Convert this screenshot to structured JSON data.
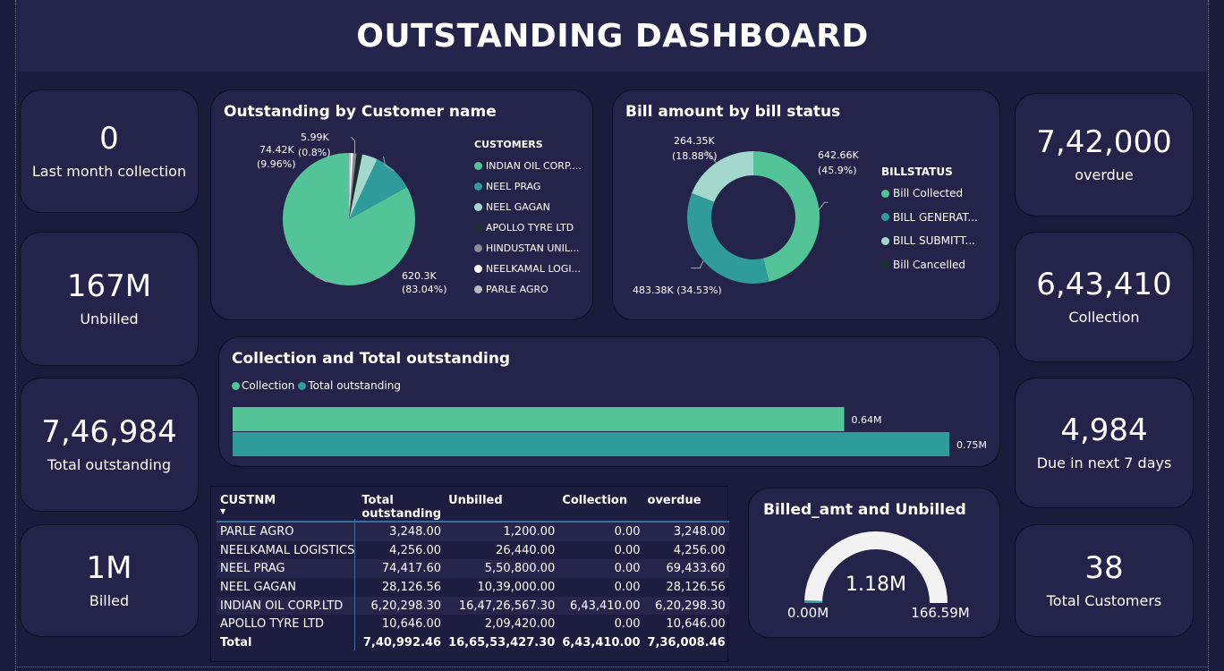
{
  "header": {
    "title": "OUTSTANDING DASHBOARD"
  },
  "kpis_left": [
    {
      "value": "0",
      "label": "Last month collection"
    },
    {
      "value": "167M",
      "label": "Unbilled"
    },
    {
      "value": "7,46,984",
      "label": "Total outstanding"
    },
    {
      "value": "1M",
      "label": "Billed"
    }
  ],
  "kpis_right": [
    {
      "value": "7,42,000",
      "label": "overdue"
    },
    {
      "value": "6,43,410",
      "label": "Collection"
    },
    {
      "value": "4,984",
      "label": "Due in next 7 days"
    },
    {
      "value": "38",
      "label": "Total Customers"
    }
  ],
  "colors": {
    "background": "#1b1b3c",
    "card": "#24244a",
    "green": "#52c498",
    "teal": "#2f9b9b",
    "light_teal": "#a4d8cc",
    "dark": "#1d2d2d",
    "gray": "#8a8a9a",
    "white": "#ffffff",
    "silver": "#b9b9c4",
    "gauge_track": "#f2f2f2"
  },
  "chart_data": [
    {
      "type": "pie",
      "title": "Outstanding by Customer name",
      "legend_title": "CUSTOMERS",
      "legend_position": "right",
      "slices": [
        {
          "name": "INDIAN OIL CORP....",
          "value": 620300,
          "label": "620.3K",
          "pct": "(83.04%)",
          "color": "#52c498"
        },
        {
          "name": "NEEL PRAG",
          "value": 74420,
          "label": "74.42K",
          "pct": "(9.96%)",
          "color": "#2f9b9b"
        },
        {
          "name": "NEEL GAGAN",
          "value": 28127,
          "label": "",
          "pct": "",
          "color": "#a4d8cc"
        },
        {
          "name": "APOLLO TYRE LTD",
          "value": 10646,
          "label": "",
          "pct": "",
          "color": "#1d2d2d"
        },
        {
          "name": "HINDUSTAN UNIL...",
          "value": 5990,
          "label": "5.99K",
          "pct": "(0.8%)",
          "color": "#8a8a9a"
        },
        {
          "name": "NEELKAMAL LOGI...",
          "value": 4256,
          "label": "",
          "pct": "",
          "color": "#ffffff"
        },
        {
          "name": "PARLE AGRO",
          "value": 3248,
          "label": "",
          "pct": "",
          "color": "#b9b9c4"
        }
      ]
    },
    {
      "type": "pie",
      "subtype": "donut",
      "title": "Bill amount by bill status",
      "legend_title": "BILLSTATUS",
      "legend_position": "right",
      "slices": [
        {
          "name": "Bill Collected",
          "value": 642660,
          "label": "642.66K",
          "pct": "(45.9%)",
          "color": "#52c498"
        },
        {
          "name": "BILL GENERAT...",
          "value": 483380,
          "label": "483.38K (34.53%)",
          "pct": "",
          "color": "#2f9b9b"
        },
        {
          "name": "BILL SUBMITT...",
          "value": 264350,
          "label": "264.35K",
          "pct": "(18.88%)",
          "color": "#a4d8cc"
        },
        {
          "name": "Bill Cancelled",
          "value": 0,
          "label": "",
          "pct": "",
          "color": "#1d2d2d"
        }
      ]
    },
    {
      "type": "bar",
      "orientation": "horizontal",
      "title": "Collection and Total outstanding",
      "legend_position": "top-left",
      "xlim": [
        0,
        0.8
      ],
      "series": [
        {
          "name": "Collection",
          "value": 0.64,
          "label": "0.64M",
          "color": "#52c498"
        },
        {
          "name": "Total outstanding",
          "value": 0.75,
          "label": "0.75M",
          "color": "#2f9b9b"
        }
      ]
    },
    {
      "type": "gauge",
      "title": "Billed_amt and Unbilled",
      "value": 1.18,
      "value_label": "1.18M",
      "min_label": "0.00M",
      "max_label": "166.59M",
      "min": 0,
      "max": 166.59
    }
  ],
  "table": {
    "sort_indicator": "▼",
    "columns": [
      "CUSTNM",
      "Total outstanding",
      "Unbilled",
      "Collection",
      "overdue"
    ],
    "rows": [
      [
        "PARLE AGRO",
        "3,248.00",
        "1,200.00",
        "0.00",
        "3,248.00"
      ],
      [
        "NEELKAMAL LOGISTICS",
        "4,256.00",
        "26,440.00",
        "0.00",
        "4,256.00"
      ],
      [
        "NEEL PRAG",
        "74,417.60",
        "5,50,800.00",
        "0.00",
        "69,433.60"
      ],
      [
        "NEEL GAGAN",
        "28,126.56",
        "10,39,000.00",
        "0.00",
        "28,126.56"
      ],
      [
        "INDIAN OIL CORP.LTD",
        "6,20,298.30",
        "16,47,26,567.30",
        "6,43,410.00",
        "6,20,298.30"
      ],
      [
        "APOLLO TYRE LTD",
        "10,646.00",
        "2,09,420.00",
        "0.00",
        "10,646.00"
      ]
    ],
    "total": [
      "Total",
      "7,40,992.46",
      "16,65,53,427.30",
      "6,43,410.00",
      "7,36,008.46"
    ]
  }
}
